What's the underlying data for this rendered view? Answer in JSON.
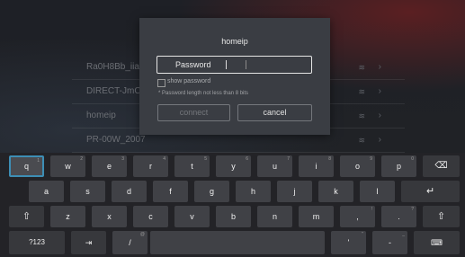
{
  "networks": [
    {
      "name": "Ra0H8Bb_iiahn"
    },
    {
      "name": "DIRECT-JmC18P"
    },
    {
      "name": "homeip"
    },
    {
      "name": "PR-00W_2007"
    }
  ],
  "network_signal_icon": "wifi-lock-icon",
  "network_chevron": "›",
  "dialog": {
    "title": "homeip",
    "password_label": "Password",
    "show_password_label": "show password",
    "hint": "* Password length not less than 8 bits",
    "connect_label": "connect",
    "cancel_label": "cancel"
  },
  "keyboard": {
    "row1": [
      "q",
      "w",
      "e",
      "r",
      "t",
      "y",
      "u",
      "i",
      "o",
      "p"
    ],
    "row1_hints": [
      "1",
      "2",
      "3",
      "4",
      "5",
      "6",
      "7",
      "8",
      "9",
      "0"
    ],
    "row2": [
      "a",
      "s",
      "d",
      "f",
      "g",
      "h",
      "j",
      "k",
      "l"
    ],
    "row3": [
      "z",
      "x",
      "c",
      "v",
      "b",
      "n",
      "m",
      ",",
      "."
    ],
    "row3_hints": [
      "",
      "",
      "",
      "",
      "",
      "",
      "",
      "!",
      "?"
    ],
    "backspace_icon": "⌫",
    "enter_icon": "↵",
    "shift_icon": "⇧",
    "sym_label": "?123",
    "tab_icon": "⇥",
    "slash_label": "/",
    "slash_hint": "@",
    "apostrophe_label": "'",
    "apostrophe_hint": "\"",
    "dash_label": "-",
    "dash_hint": "_",
    "hide_icon": "⌨"
  }
}
